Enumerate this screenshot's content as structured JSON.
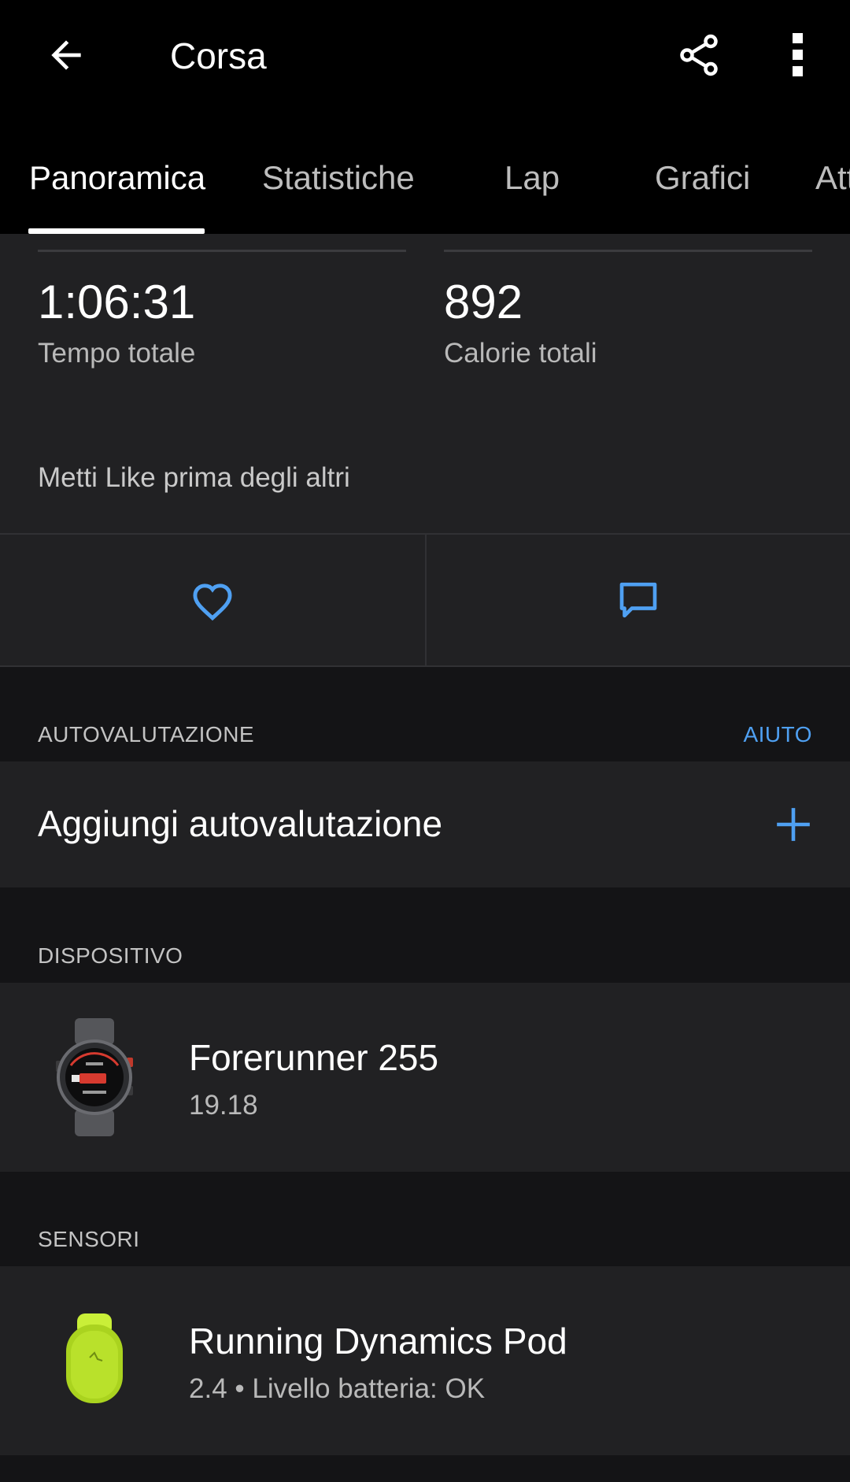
{
  "header": {
    "title": "Corsa",
    "back_icon": "arrow-left-icon",
    "share_icon": "share-icon",
    "more_icon": "more-vertical-icon"
  },
  "tabs": [
    {
      "label": "Panoramica",
      "active": true
    },
    {
      "label": "Statistiche",
      "active": false
    },
    {
      "label": "Lap",
      "active": false
    },
    {
      "label": "Grafici",
      "active": false
    },
    {
      "label": "Att",
      "active": false
    }
  ],
  "stats": {
    "total_time": {
      "value": "1:06:31",
      "label": "Tempo totale"
    },
    "total_calories": {
      "value": "892",
      "label": "Calorie totali"
    }
  },
  "social": {
    "like_prompt": "Metti Like prima degli altri",
    "like_icon": "heart-icon",
    "comment_icon": "comment-icon"
  },
  "self_evaluation": {
    "section_title": "AUTOVALUTAZIONE",
    "help_label": "AIUTO",
    "add_label": "Aggiungi autovalutazione",
    "add_icon": "plus-icon"
  },
  "device": {
    "section_title": "DISPOSITIVO",
    "name": "Forerunner 255",
    "version": "19.18"
  },
  "sensors": {
    "section_title": "SENSORI",
    "name": "Running Dynamics Pod",
    "detail": "2.4 • Livello batteria: OK"
  },
  "colors": {
    "accent": "#4fa0f2",
    "background": "#141416",
    "panel": "#212123",
    "header": "#000000",
    "pod_green": "#b4e12b"
  }
}
